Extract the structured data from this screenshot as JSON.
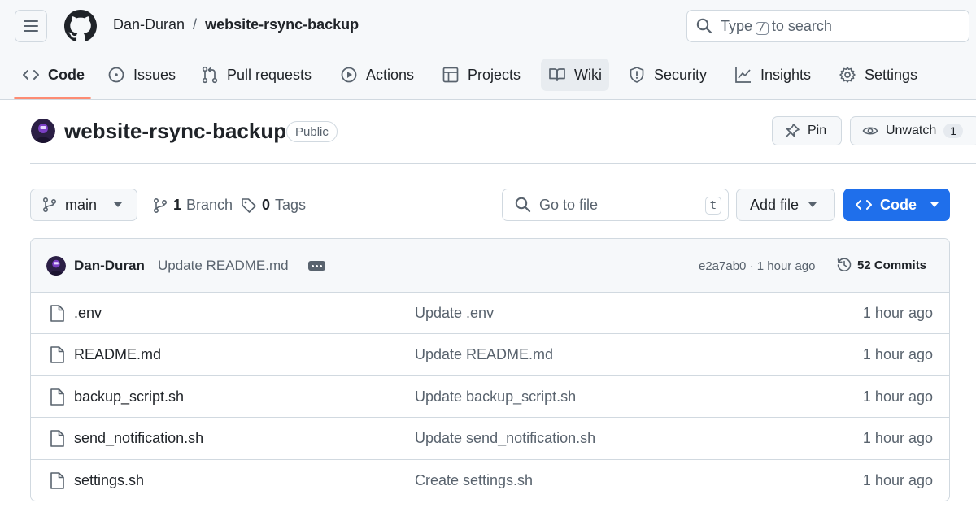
{
  "header": {
    "owner": "Dan-Duran",
    "separator": "/",
    "repo": "website-rsync-backup",
    "search": {
      "prefix": "Type",
      "key": "/",
      "suffix": "to search"
    }
  },
  "tabs": [
    {
      "label": "Code",
      "icon": "code-icon",
      "selected": true
    },
    {
      "label": "Issues",
      "icon": "issue-opened-icon"
    },
    {
      "label": "Pull requests",
      "icon": "git-pull-request-icon"
    },
    {
      "label": "Actions",
      "icon": "play-icon"
    },
    {
      "label": "Projects",
      "icon": "table-icon"
    },
    {
      "label": "Wiki",
      "icon": "book-icon"
    },
    {
      "label": "Security",
      "icon": "shield-icon"
    },
    {
      "label": "Insights",
      "icon": "graph-icon"
    },
    {
      "label": "Settings",
      "icon": "gear-icon"
    }
  ],
  "repo_head": {
    "title": "website-rsync-backup",
    "visibility": "Public",
    "pin_label": "Pin",
    "unwatch_label": "Unwatch",
    "watch_count": "1"
  },
  "toolbar": {
    "branch": "main",
    "branch_count": "1",
    "branch_label": "Branch",
    "tag_count": "0",
    "tag_label": "Tags",
    "goto_placeholder": "Go to file",
    "goto_key": "t",
    "add_file_label": "Add file",
    "code_label": "Code"
  },
  "latest_commit": {
    "author": "Dan-Duran",
    "message": "Update README.md",
    "sha": "e2a7ab0",
    "dot": "·",
    "time": "1 hour ago",
    "commits_label": "52 Commits"
  },
  "files": [
    {
      "name": ".env",
      "message": "Update .env",
      "time": "1 hour ago"
    },
    {
      "name": "README.md",
      "message": "Update README.md",
      "time": "1 hour ago"
    },
    {
      "name": "backup_script.sh",
      "message": "Update backup_script.sh",
      "time": "1 hour ago"
    },
    {
      "name": "send_notification.sh",
      "message": "Update send_notification.sh",
      "time": "1 hour ago"
    },
    {
      "name": "settings.sh",
      "message": "Create settings.sh",
      "time": "1 hour ago"
    }
  ],
  "colors": {
    "accent_blue": "#1f6feb",
    "tab_underline": "#fd8c73",
    "muted_text": "#59636e",
    "border": "#d1d9e0"
  }
}
